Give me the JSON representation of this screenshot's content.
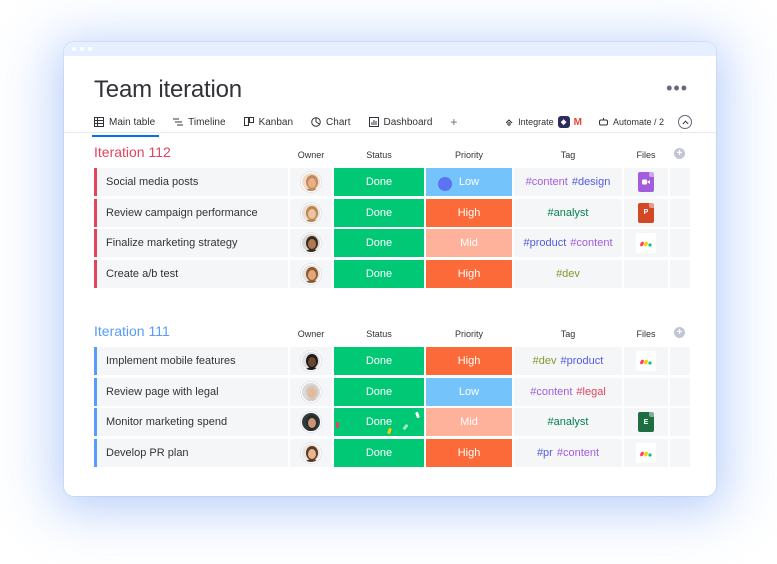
{
  "board": {
    "title": "Team iteration"
  },
  "tabs": [
    {
      "label": "Main table",
      "icon": "table-icon"
    },
    {
      "label": "Timeline",
      "icon": "timeline-icon"
    },
    {
      "label": "Kanban",
      "icon": "kanban-icon"
    },
    {
      "label": "Chart",
      "icon": "chart-icon"
    },
    {
      "label": "Dashboard",
      "icon": "dashboard-icon"
    }
  ],
  "toolbar": {
    "add_tab": "+",
    "integrate_label": "Integrate",
    "automate_label": "Automate / 2",
    "more": "•••",
    "collapse": "^"
  },
  "columns": {
    "owner": "Owner",
    "status": "Status",
    "priority": "Priority",
    "tag": "Tag",
    "files": "Files",
    "add": "+"
  },
  "colors": {
    "done": "#00c875",
    "high": "#fd6a3a",
    "mid": "#feb19b",
    "low": "#74c3fb",
    "group1": "#e2445c",
    "group2": "#579bfc",
    "tag_blue": "#5559df",
    "tag_purple": "#a25ddc",
    "tag_green": "#037f4c",
    "tag_olive": "#7f9a2e",
    "tag_red": "#e2445c"
  },
  "groups": [
    {
      "title": "Iteration 112",
      "color": "#e2445c",
      "rows": [
        {
          "name": "Social media posts",
          "avatar": "woman-1",
          "status": "Done",
          "priority": "Low",
          "tags": [
            {
              "text": "#content",
              "color": "#a25ddc"
            },
            {
              "text": "#design",
              "color": "#5559df"
            }
          ],
          "file": {
            "type": "video",
            "color": "#a25ddc",
            "label": ""
          }
        },
        {
          "name": "Review campaign performance",
          "avatar": "woman-2",
          "status": "Done",
          "priority": "High",
          "tags": [
            {
              "text": "#analyst",
              "color": "#037f4c"
            }
          ],
          "file": {
            "type": "ppt",
            "color": "#d24726",
            "label": "P"
          }
        },
        {
          "name": "Finalize marketing strategy",
          "avatar": "man-1",
          "status": "Done",
          "priority": "Mid",
          "tags": [
            {
              "text": "#product",
              "color": "#5559df"
            },
            {
              "text": "#content",
              "color": "#a25ddc"
            }
          ],
          "file": {
            "type": "monday",
            "color": "",
            "label": ""
          }
        },
        {
          "name": "Create a/b test",
          "avatar": "woman-3",
          "status": "Done",
          "priority": "High",
          "tags": [
            {
              "text": "#dev",
              "color": "#7f9a2e"
            }
          ],
          "file": {
            "type": "none",
            "color": "",
            "label": ""
          }
        }
      ]
    },
    {
      "title": "Iteration 111",
      "color": "#579bfc",
      "rows": [
        {
          "name": "Implement mobile features",
          "avatar": "man-2",
          "status": "Done",
          "priority": "High",
          "tags": [
            {
              "text": "#dev",
              "color": "#7f9a2e"
            },
            {
              "text": "#product",
              "color": "#5559df"
            }
          ],
          "file": {
            "type": "monday",
            "color": "",
            "label": ""
          }
        },
        {
          "name": "Review page with legal",
          "avatar": "man-3",
          "status": "Done",
          "priority": "Low",
          "tags": [
            {
              "text": "#content",
              "color": "#a25ddc"
            },
            {
              "text": "#legal",
              "color": "#e2445c"
            }
          ],
          "file": {
            "type": "none",
            "color": "",
            "label": ""
          }
        },
        {
          "name": "Monitor marketing spend",
          "avatar": "man-4",
          "status": "Done",
          "priority": "Mid",
          "tags": [
            {
              "text": "#analyst",
              "color": "#037f4c"
            }
          ],
          "file": {
            "type": "excel",
            "color": "#1d6f42",
            "label": "E"
          }
        },
        {
          "name": "Develop PR plan",
          "avatar": "woman-4",
          "status": "Done",
          "priority": "High",
          "tags": [
            {
              "text": "#pr",
              "color": "#5559df"
            },
            {
              "text": "#content",
              "color": "#a25ddc"
            }
          ],
          "file": {
            "type": "monday",
            "color": "",
            "label": ""
          }
        }
      ]
    }
  ]
}
